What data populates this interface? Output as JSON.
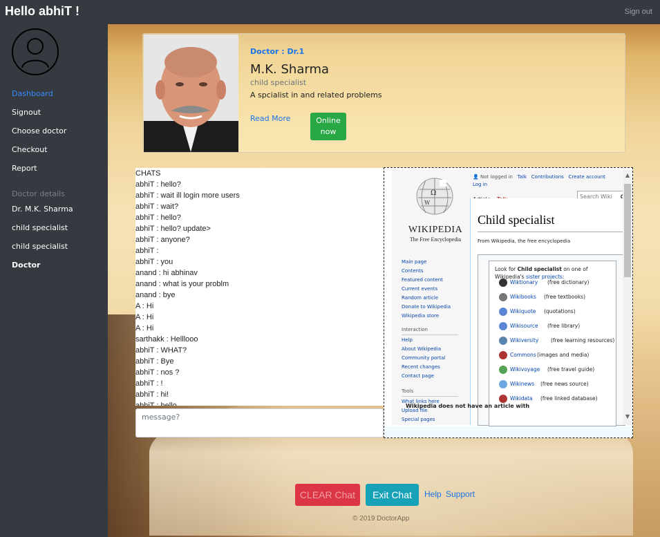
{
  "header": {
    "brand": "Hello abhiT !",
    "signout": "Sign out"
  },
  "sidebar": {
    "items": [
      {
        "label": "Dashboard"
      },
      {
        "label": "Signout"
      },
      {
        "label": "Choose doctor"
      },
      {
        "label": "Checkout"
      },
      {
        "label": "Report"
      }
    ],
    "details_heading": "Doctor details",
    "details": [
      "Dr. M.K. Sharma",
      "child specialist",
      "child specialist",
      "Doctor"
    ]
  },
  "doctor": {
    "title": "Doctor : Dr.1",
    "name": "M.K. Sharma",
    "specialty": "child specialist",
    "description": "A spcialist in and related problems",
    "read_more": "Read More",
    "status_line1": "Online",
    "status_line2": "now"
  },
  "chat": {
    "lines": [
      "CHATS",
      "abhiT : hello?",
      "abhiT : wait ill login more users",
      "abhiT : wait?",
      "abhiT : hello?",
      "abhiT : hello? update>",
      "abhiT : anyone?",
      "abhiT :",
      "abhiT : you",
      "anand : hi abhinav",
      "anand : what is your problm",
      "anand : bye",
      "A : Hi",
      "A : Hi",
      "A : Hi",
      "sarthakk : Helllooo",
      "abhiT : WHAT?",
      "abhiT : Bye",
      "abhiT : nos ?",
      "abhiT : !",
      "abhiT : hi!",
      "abhiT : hello"
    ],
    "input_placeholder": "message?"
  },
  "wiki": {
    "not_logged_in": "Not logged in",
    "talk": "Talk",
    "contributions": "Contributions",
    "create_account": "Create account",
    "log_in": "Log in",
    "tab_article": "Article",
    "tab_talk": "Talk",
    "search_placeholder": "Search Wiki",
    "wordmark": "WIKIPEDIA",
    "tagline": "The Free Encyclopedia",
    "nav_links": [
      "Main page",
      "Contents",
      "Featured content",
      "Current events",
      "Random article",
      "Donate to Wikipedia",
      "Wikipedia store"
    ],
    "interaction_heading": "Interaction",
    "interaction_links": [
      "Help",
      "About Wikipedia",
      "Community portal",
      "Recent changes",
      "Contact page"
    ],
    "tools_heading": "Tools",
    "tools_links": [
      "What links here",
      "Upload file",
      "Special pages"
    ],
    "title": "Child specialist",
    "from": "From Wikipedia, the free encyclopedia",
    "box_intro_1": "Look for ",
    "box_intro_bold": "Child specialist",
    "box_intro_2": " on one of Wikipedia's ",
    "box_intro_link": "sister projects",
    "box_intro_3": ":",
    "sisters": [
      {
        "name": "Wiktionary",
        "desc": "(free dictionary)",
        "icon": "wiktionary-icon"
      },
      {
        "name": "Wikibooks",
        "desc": "(free textbooks)",
        "icon": "wikibooks-icon"
      },
      {
        "name": "Wikiquote",
        "desc": "(quotations)",
        "icon": "wikiquote-icon"
      },
      {
        "name": "Wikisource",
        "desc": "(free library)",
        "icon": "wikisource-icon"
      },
      {
        "name": "Wikiversity",
        "desc": "(free learning resources)",
        "icon": "wikiversity-icon"
      },
      {
        "name": "Commons",
        "desc": "(images and media)",
        "icon": "commons-icon"
      },
      {
        "name": "Wikivoyage",
        "desc": "(free travel guide)",
        "icon": "wikivoyage-icon"
      },
      {
        "name": "Wikinews",
        "desc": "(free news source)",
        "icon": "wikinews-icon"
      },
      {
        "name": "Wikidata",
        "desc": "(free linked database)",
        "icon": "wikidata-icon"
      }
    ],
    "bottom_note": "Wikipedia does not have an article with"
  },
  "footer": {
    "clear_chat": "CLEAR Chat",
    "exit_chat": "Exit Chat",
    "help": "Help",
    "support": "Support",
    "copyright": "© 2019 DoctorApp"
  },
  "colors": {
    "sidebar_bg": "#343a40",
    "active_link": "#3b8bff",
    "online": "#28a745",
    "clear": "#dc3545",
    "exit": "#17a2b8"
  }
}
